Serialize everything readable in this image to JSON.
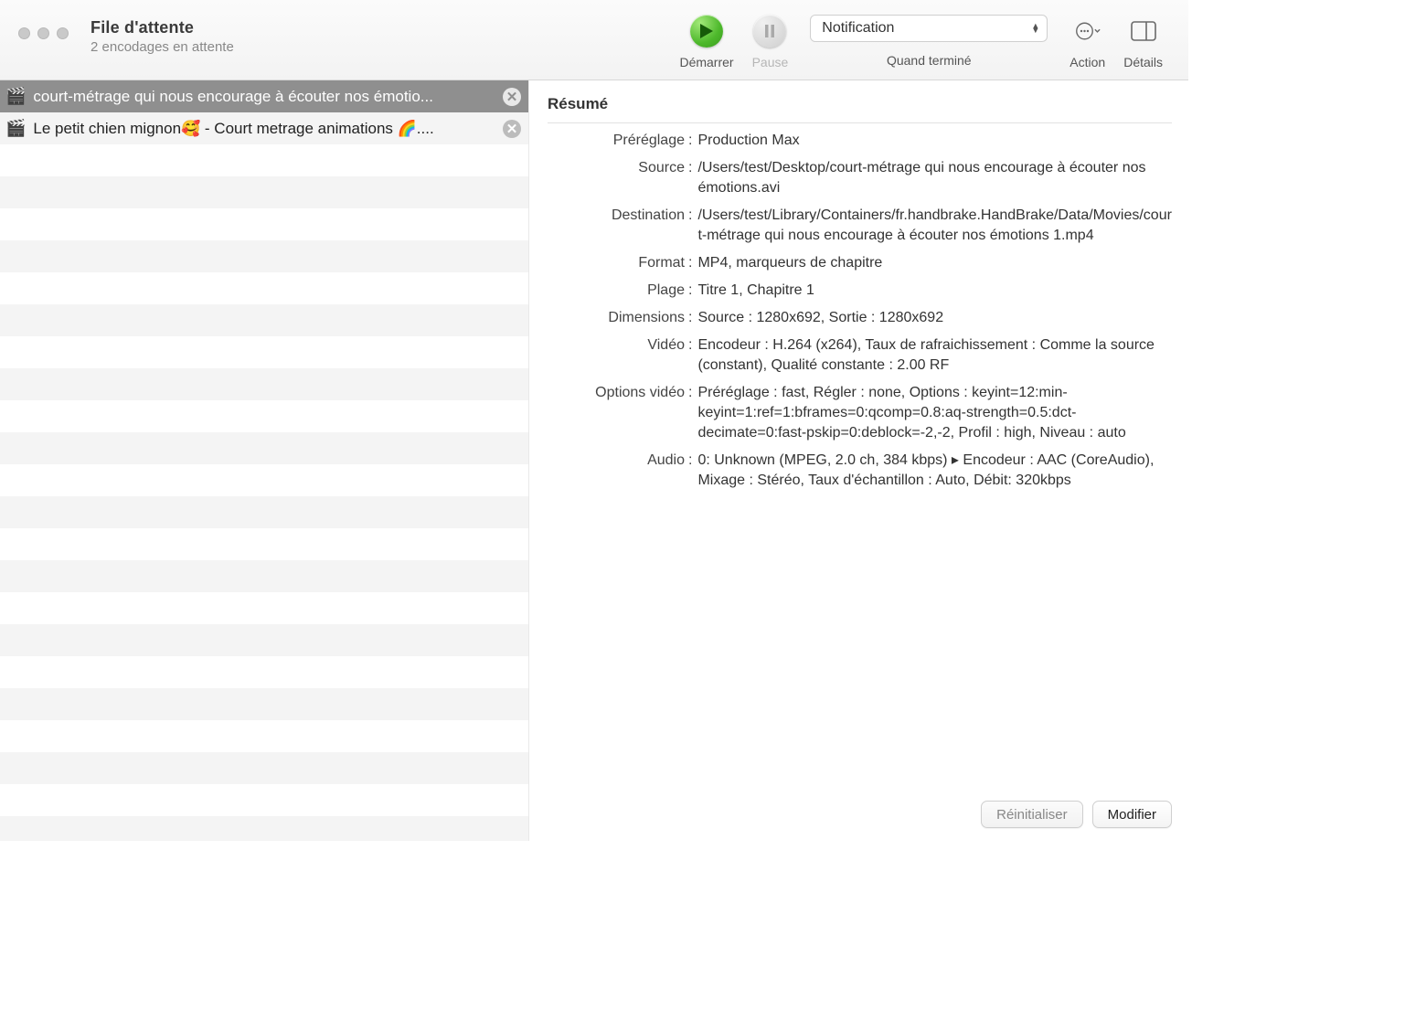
{
  "header": {
    "title": "File d'attente",
    "subtitle": "2 encodages en attente"
  },
  "toolbar": {
    "start_label": "Démarrer",
    "pause_label": "Pause",
    "when_done": {
      "selected": "Notification",
      "label": "Quand terminé"
    },
    "action_label": "Action",
    "details_label": "Détails"
  },
  "queue": {
    "items": [
      {
        "title": "court-métrage qui nous encourage à écouter nos émotio...",
        "selected": true
      },
      {
        "title": "Le petit chien mignon🥰 - Court metrage animations 🌈....",
        "selected": false
      }
    ]
  },
  "summary": {
    "heading": "Résumé",
    "rows": {
      "preset": {
        "label": "Préréglage",
        "value": "Production Max"
      },
      "source": {
        "label": "Source",
        "value": "/Users/test/Desktop/court-métrage qui nous encourage à écouter nos émotions.avi"
      },
      "destination": {
        "label": "Destination",
        "value": "/Users/test/Library/Containers/fr.handbrake.HandBrake/Data/Movies/court-métrage qui nous encourage à écouter nos émotions 1.mp4"
      },
      "format": {
        "label": "Format",
        "value": "MP4, marqueurs de chapitre"
      },
      "range": {
        "label": "Plage",
        "value": "Titre 1, Chapitre 1"
      },
      "dimensions": {
        "label": "Dimensions",
        "value": "Source : 1280x692, Sortie : 1280x692"
      },
      "video": {
        "label": "Vidéo",
        "value": "Encodeur : H.264 (x264), Taux de rafraichissement : Comme la source (constant), Qualité constante : 2.00 RF"
      },
      "video_options": {
        "label": "Options vidéo",
        "value": "Préréglage : fast, Régler : none, Options : keyint=12:min-keyint=1:ref=1:bframes=0:qcomp=0.8:aq-strength=0.5:dct-decimate=0:fast-pskip=0:deblock=-2,-2, Profil : high, Niveau : auto"
      },
      "audio": {
        "label": "Audio",
        "value": "0: Unknown (MPEG, 2.0 ch, 384 kbps) ▸ Encodeur : AAC (CoreAudio), Mixage : Stéréo, Taux d'échantillon : Auto, Débit: 320kbps"
      }
    }
  },
  "footer": {
    "reset_label": "Réinitialiser",
    "modify_label": "Modifier"
  }
}
